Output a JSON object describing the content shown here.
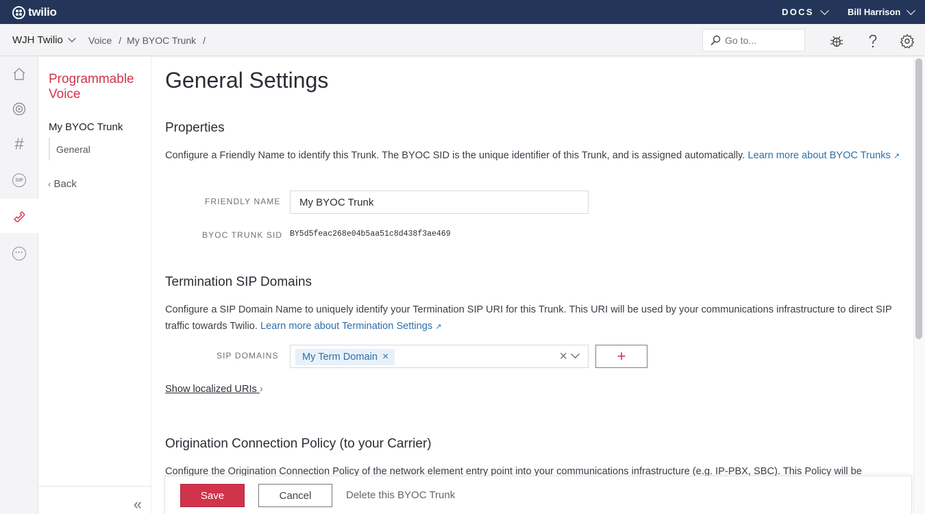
{
  "topbar": {
    "logo_text": "twilio",
    "docs_label": "DOCS",
    "user_name": "Bill Harrison"
  },
  "subbar": {
    "account_name": "WJH Twilio",
    "breadcrumbs": [
      "Voice",
      "My BYOC Trunk"
    ],
    "search_placeholder": "Go to..."
  },
  "rail": {
    "items": [
      "home-icon",
      "signal-icon",
      "hash-icon",
      "sip-icon",
      "phone-icon",
      "more-icon"
    ],
    "active": "phone-icon",
    "sip_text": "SIP",
    "hash_text": "#",
    "more_text": "···"
  },
  "secnav": {
    "product_title": "Programmable Voice",
    "trunk_name": "My BYOC Trunk",
    "sub_item": "General",
    "back_label": "Back"
  },
  "page": {
    "title": "General Settings",
    "properties": {
      "heading": "Properties",
      "desc": "Configure a Friendly Name to identify this Trunk. The BYOC SID is the unique identifier of this Trunk, and is assigned automatically. ",
      "link": "Learn more about BYOC Trunks",
      "friendly_name_label": "FRIENDLY NAME",
      "friendly_name_value": "My BYOC Trunk",
      "sid_label": "BYOC TRUNK SID",
      "sid_value": "BY5d5feac268e04b5aa51c8d438f3ae469"
    },
    "termination": {
      "heading": "Termination SIP Domains",
      "desc": "Configure a SIP Domain Name to uniquely identify your Termination SIP URI for this Trunk. This URI will be used by your communications infrastructure to direct SIP traffic towards Twilio. ",
      "link": "Learn more about Termination Settings",
      "sip_domains_label": "SIP DOMAINS",
      "selected_domain": "My Term Domain",
      "add_label": "+",
      "show_localized": "Show localized URIs"
    },
    "origination": {
      "heading": "Origination Connection Policy (to your Carrier)",
      "desc": "Configure the Origination Connection Policy of the network element entry point into your communications infrastructure (e.g. IP-PBX, SBC). This Policy will be"
    }
  },
  "actions": {
    "save": "Save",
    "cancel": "Cancel",
    "delete": "Delete this BYOC Trunk"
  },
  "colors": {
    "topbar": "#233659",
    "brand_red": "#d1334b",
    "link_blue": "#2f6fa8"
  }
}
